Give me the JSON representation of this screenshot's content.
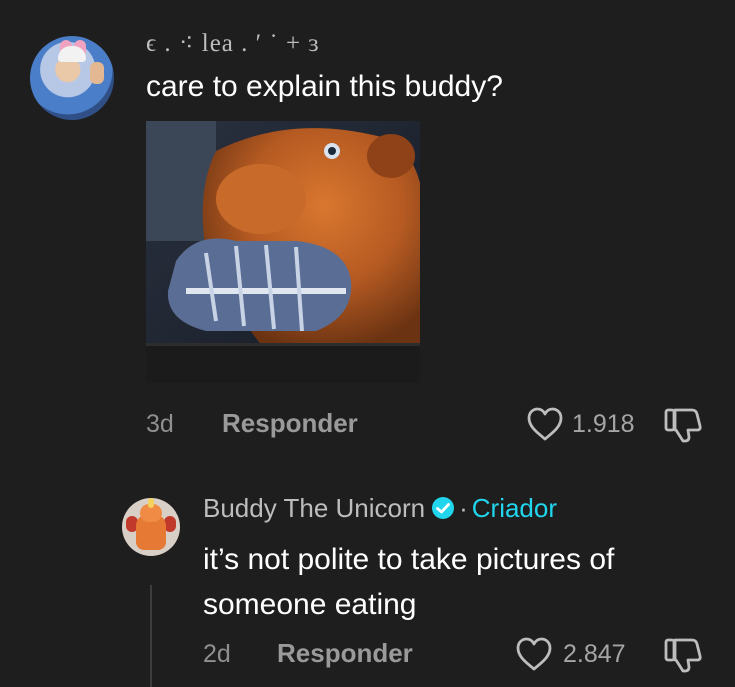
{
  "comment": {
    "username": "ϵ . ⁖ lea . ′ ˙ + ɜ",
    "text": "care to explain this buddy?",
    "time": "3d",
    "reply_label": "Responder",
    "likes": "1.918",
    "attached_image": "photo of orange plush bear chewing a blue and white sneaker"
  },
  "reply": {
    "author": "Buddy The Unicorn",
    "separator": "·",
    "creator_tag": "Criador",
    "text": "it’s not polite to take pictures of someone eating",
    "time": "2d",
    "reply_label": "Responder",
    "likes": "2.847"
  },
  "icons": {
    "like": "heart-outline-icon",
    "dislike": "thumbs-down-outline-icon",
    "verified": "verified-check-icon"
  },
  "colors": {
    "background": "#1e1e1e",
    "creator_accent": "#20d5ec",
    "verified_badge": "#20d5ec",
    "muted_text": "#9a9a9a"
  }
}
